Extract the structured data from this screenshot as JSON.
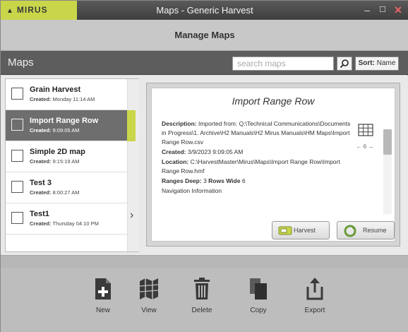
{
  "app": {
    "logo_text": "MIRUS",
    "window_title": "Maps - Generic Harvest",
    "minimize_symbol": "–",
    "maximize_symbol": "☐",
    "close_symbol": "✕",
    "accent_color": "#c9d64a"
  },
  "header": {
    "title": "Manage Maps"
  },
  "maps_bar": {
    "title": "Maps",
    "search_placeholder": "search maps",
    "sort_prefix": "Sort:",
    "sort_value": "Name"
  },
  "maps_list": {
    "created_prefix": "Created:",
    "items": [
      {
        "name": "Grain Harvest",
        "created": "Monday 11:14 AM",
        "selected": false
      },
      {
        "name": "Import Range Row",
        "created": "9:09:05 AM",
        "selected": true
      },
      {
        "name": "Simple 2D map",
        "created": "9:15:19 AM",
        "selected": false
      },
      {
        "name": "Test 3",
        "created": "8:00:27 AM",
        "selected": false
      },
      {
        "name": "Test1",
        "created": "Thursday 04:10 PM",
        "selected": false
      }
    ]
  },
  "detail": {
    "title": "Import Range Row",
    "description_label": "Description:",
    "description_value": "Imported from: Q:\\Technical Communications\\Documents in Progress\\1. Archive\\H2 Manuals\\H2 Mirus Manuals\\HM Maps\\Import Range Row.csv",
    "created_label": "Created:",
    "created_value": "3/9/2023 9:09:05 AM",
    "location_label": "Location:",
    "location_value": "C:\\HarvestMaster\\Mirus\\Maps\\Import Range Row\\Import Range Row.hmf",
    "ranges_label": "Ranges Deep:",
    "ranges_value": "3",
    "rows_label": "Rows Wide",
    "rows_value": "6",
    "navigation_text": "Navigation Information",
    "grid_count": "6",
    "harvest_button": "Harvest",
    "resume_button": "Resume"
  },
  "toolbar": {
    "new_label": "New",
    "view_label": "View",
    "delete_label": "Delete",
    "copy_label": "Copy",
    "export_label": "Export"
  }
}
